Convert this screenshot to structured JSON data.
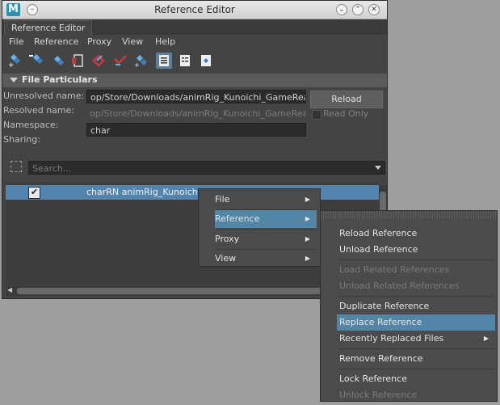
{
  "window": {
    "title": "Reference Editor",
    "app_logo": "M"
  },
  "tabs": [
    {
      "label": "Reference Editor"
    }
  ],
  "menubar": [
    "File",
    "Reference",
    "Proxy",
    "View",
    "Help"
  ],
  "toolbar_icons": [
    "load-reference-icon",
    "unload-reference-icon",
    "reload-reference-icon",
    "select-file-icon",
    "list-edits-icon",
    "remove-edits-icon",
    "duplicate-reference-icon",
    "list-view-icon",
    "details-view-icon",
    "object-view-icon"
  ],
  "section": {
    "title": "File Particulars"
  },
  "fields": {
    "unresolved_label": "Unresolved name:",
    "unresolved_value": "op/Store/Downloads/animRig_Kunoichi_GameReady.ma",
    "resolved_label": "Resolved name:",
    "resolved_value": "op/Store/Downloads/animRig_Kunoichi_GameReady.ma",
    "namespace_label": "Namespace:",
    "namespace_value": "char",
    "sharing_label": "Sharing:"
  },
  "reload_button": "Reload",
  "read_only_label": "Read Only",
  "search": {
    "placeholder": "Search..."
  },
  "list": {
    "rows": [
      {
        "text": "charRN animRig_Kunoichi_GameReady",
        "checked": true
      }
    ]
  },
  "context_menu": {
    "items": [
      "File",
      "Reference",
      "Proxy",
      "View"
    ],
    "highlighted": "Reference"
  },
  "submenu": {
    "items": [
      {
        "label": "Reload Reference",
        "enabled": true
      },
      {
        "label": "Unload Reference",
        "enabled": true
      },
      {
        "label": "Load Related References",
        "enabled": false
      },
      {
        "label": "Unload Related References",
        "enabled": false
      },
      {
        "label": "Duplicate Reference",
        "enabled": true
      },
      {
        "label": "Replace Reference",
        "enabled": true,
        "highlighted": true
      },
      {
        "label": "Recently Replaced Files",
        "enabled": true,
        "submenu": true
      },
      {
        "label": "Remove Reference",
        "enabled": true
      },
      {
        "label": "Lock Reference",
        "enabled": true
      },
      {
        "label": "Unlock Reference",
        "enabled": false
      }
    ]
  },
  "colors": {
    "highlight": "#5285a6",
    "panel": "#444444",
    "background": "#9e9e9e"
  }
}
